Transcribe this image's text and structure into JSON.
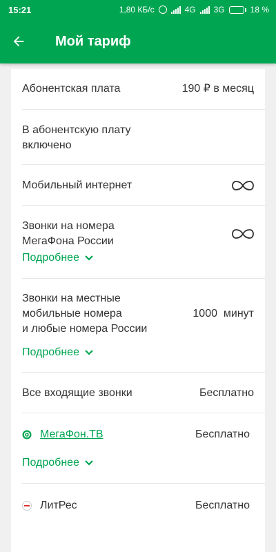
{
  "status_bar": {
    "time": "15:21",
    "speed": "1,80 КБ/с",
    "net1": "4G",
    "net2": "3G",
    "battery": "18 %",
    "battery_level": 0.18
  },
  "app_bar": {
    "title": "Мой тариф"
  },
  "tariff": {
    "fee_label": "Абонентская плата",
    "fee_value": "190 ₽ в месяц",
    "included_label_line1": "В абонентскую плату",
    "included_label_line2": "включено",
    "internet_label": "Мобильный интернет",
    "calls_mf_line1": "Звонки на номера",
    "calls_mf_line2": "МегаФона России",
    "more_label": "Подробнее",
    "calls_local_line1": "Звонки на местные",
    "calls_local_line2": "мобильные номера",
    "calls_local_line3": "и любые номера России",
    "calls_local_value": "1000  минут",
    "incoming_label": "Все входящие звонки",
    "incoming_value": "Бесплатно",
    "megafon_tv_label": "МегаФон.ТВ",
    "megafon_tv_value": "Бесплатно",
    "litres_label": "ЛитРес",
    "litres_value": "Бесплатно"
  },
  "colors": {
    "brand": "#00a552",
    "card": "#ffffff",
    "background": "#f0f0f0"
  }
}
